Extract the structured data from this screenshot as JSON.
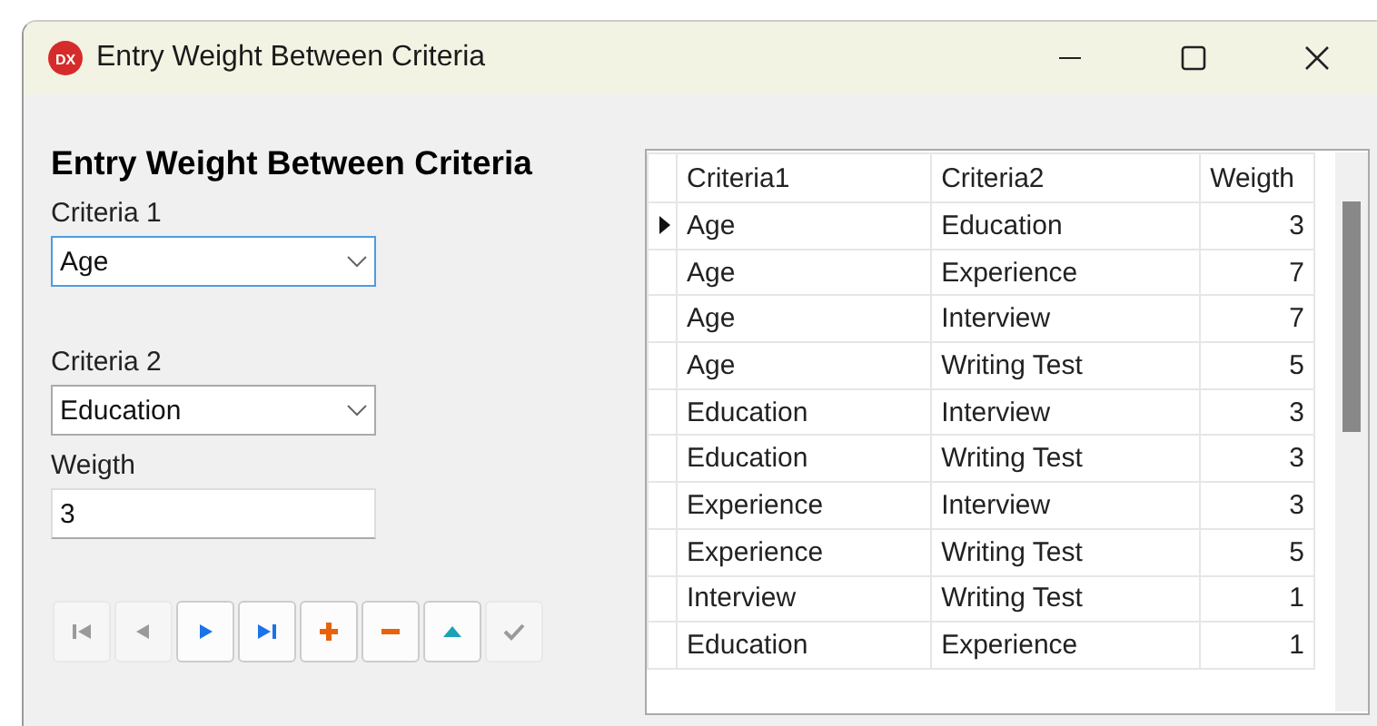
{
  "window": {
    "title": "Entry Weight Between Criteria",
    "logo_text": "DX"
  },
  "form": {
    "heading": "Entry Weight Between Criteria",
    "fields": [
      {
        "kind": "dropdown",
        "label": "Criteria 1",
        "value": "Age",
        "focused": true
      },
      {
        "kind": "dropdown",
        "label": "Criteria 2",
        "value": "Education",
        "focused": false
      },
      {
        "kind": "text",
        "label": "Weigth",
        "value": "3",
        "focused": false
      }
    ]
  },
  "navigator": [
    {
      "kind": "first",
      "disabled": true
    },
    {
      "kind": "prior",
      "disabled": true
    },
    {
      "kind": "next",
      "disabled": false
    },
    {
      "kind": "last",
      "disabled": false
    },
    {
      "kind": "insert",
      "disabled": false
    },
    {
      "kind": "delete",
      "disabled": false
    },
    {
      "kind": "edit",
      "disabled": false
    },
    {
      "kind": "post",
      "disabled": true
    }
  ],
  "table": {
    "columns": [
      "Criteria1",
      "Criteria2",
      "Weigth"
    ],
    "rows": [
      {
        "cells": [
          "Age",
          "Education",
          "3"
        ],
        "selected": true
      },
      {
        "cells": [
          "Age",
          "Experience",
          "7"
        ],
        "selected": false
      },
      {
        "cells": [
          "Age",
          "Interview",
          "7"
        ],
        "selected": false
      },
      {
        "cells": [
          "Age",
          "Writing Test",
          "5"
        ],
        "selected": false
      },
      {
        "cells": [
          "Education",
          "Interview",
          "3"
        ],
        "selected": false
      },
      {
        "cells": [
          "Education",
          "Writing Test",
          "3"
        ],
        "selected": false
      },
      {
        "cells": [
          "Experience",
          "Interview",
          "3"
        ],
        "selected": false
      },
      {
        "cells": [
          "Experience",
          "Writing Test",
          "5"
        ],
        "selected": false
      },
      {
        "cells": [
          "Interview",
          "Writing Test",
          "1"
        ],
        "selected": false
      },
      {
        "cells": [
          "Education",
          "Experience",
          "1"
        ],
        "selected": false
      }
    ]
  }
}
